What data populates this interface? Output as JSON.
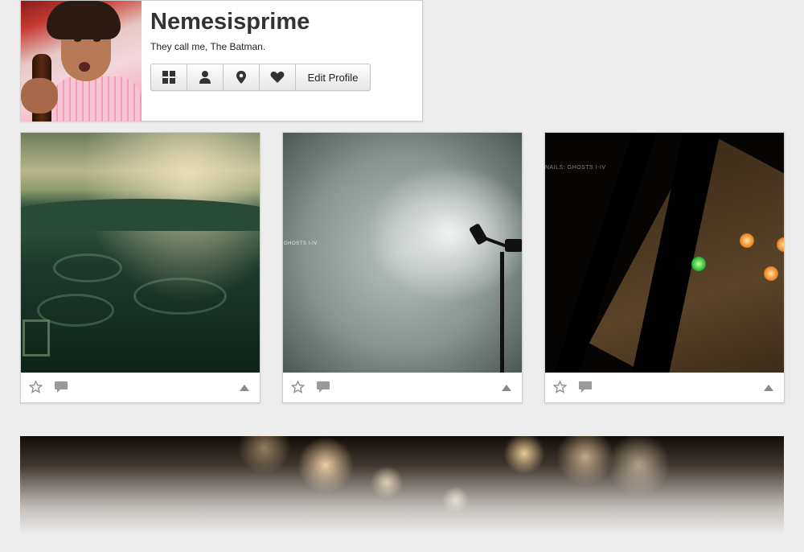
{
  "profile": {
    "username": "Nemesisprime",
    "bio": "They call me, The Batman.",
    "toolbar": {
      "grid_icon": "grid-icon",
      "person_icon": "person-icon",
      "location_icon": "map-pin-icon",
      "heart_icon": "heart-icon",
      "edit_profile_label": "Edit Profile"
    }
  },
  "posts": [
    {
      "caption": "",
      "actions": [
        "star-icon",
        "comment-icon",
        "triangle-up-icon"
      ]
    },
    {
      "caption": "GHOSTS I-IV",
      "actions": [
        "star-icon",
        "comment-icon",
        "triangle-up-icon"
      ]
    },
    {
      "caption": "NAILS: GHOSTS I-IV",
      "actions": [
        "star-icon",
        "comment-icon",
        "triangle-up-icon"
      ]
    }
  ],
  "colors": {
    "background": "#ededed",
    "card": "#ffffff",
    "border": "#cfcfcf",
    "icon_gray": "#9a9a9a",
    "title_text": "#333333"
  }
}
